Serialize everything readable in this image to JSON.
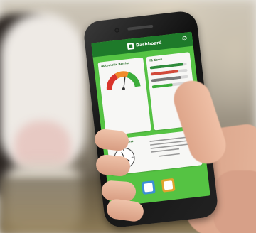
{
  "app": {
    "header_title": "Dashboard",
    "icons": {
      "logo": "dashboard-logo-icon",
      "settings": "gear-icon"
    }
  },
  "cards": {
    "gauge_card_title": "Automatic Barrier",
    "bars_card_title": "T1 Cows",
    "new_functions_title": "New Functions",
    "new_functions_text": "",
    "bar_levels": [
      0.9,
      0.75,
      0.8,
      0.55
    ]
  },
  "colors": {
    "screen_green": "#55c343",
    "header_green": "#1e7a2a",
    "gauge_red": "#d9342b",
    "gauge_orange": "#f08a2a",
    "gauge_green": "#3cad3a"
  }
}
